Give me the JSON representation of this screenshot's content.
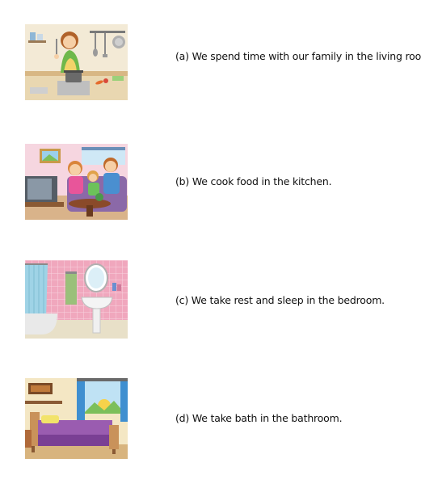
{
  "worksheet": {
    "rows": [
      {
        "picture": "kitchen-picture",
        "text": "(a) We spend time with our family in the living room."
      },
      {
        "picture": "living-room-picture",
        "text": "(b) We cook food in the kitchen."
      },
      {
        "picture": "bathroom-picture",
        "text": "(c) We take rest and sleep in the bedroom."
      },
      {
        "picture": "bedroom-picture",
        "text": "(d) We take bath in the bathroom."
      }
    ]
  }
}
